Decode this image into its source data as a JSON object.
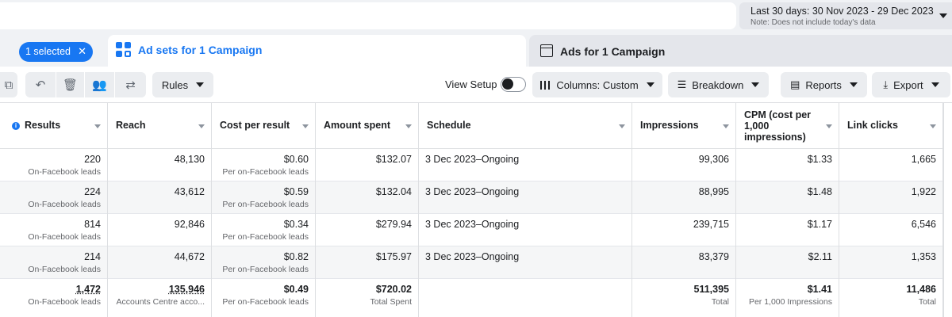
{
  "date_range": {
    "label": "Last 30 days: 30 Nov 2023 - 29 Dec 2023",
    "note": "Note: Does not include today's data"
  },
  "tabs": {
    "selected_pill": "1 selected",
    "pill_close": "✕",
    "active": "Ad sets for 1 Campaign",
    "inactive": "Ads for 1 Campaign"
  },
  "toolbar": {
    "rules": "Rules",
    "view_setup": "View Setup",
    "columns": "Columns: Custom",
    "breakdown": "Breakdown",
    "reports": "Reports",
    "export": "Export"
  },
  "columns": [
    {
      "key": "results",
      "label": "Results"
    },
    {
      "key": "reach",
      "label": "Reach"
    },
    {
      "key": "cpr",
      "label": "Cost per result"
    },
    {
      "key": "spent",
      "label": "Amount spent"
    },
    {
      "key": "schedule",
      "label": "Schedule"
    },
    {
      "key": "impressions",
      "label": "Impressions"
    },
    {
      "key": "cpm",
      "label": "CPM (cost per 1,000 impressions)"
    },
    {
      "key": "clicks",
      "label": "Link clicks"
    }
  ],
  "cpm_label_lines": [
    "CPM (cost per",
    "1,000",
    "impressions)"
  ],
  "rows": [
    {
      "results": "220",
      "results_sub": "On-Facebook leads",
      "reach": "48,130",
      "cpr": "$0.60",
      "cpr_sub": "Per on-Facebook leads",
      "spent": "$132.07",
      "schedule": "3 Dec 2023–Ongoing",
      "impressions": "99,306",
      "cpm": "$1.33",
      "clicks": "1,665"
    },
    {
      "results": "224",
      "results_sub": "On-Facebook leads",
      "reach": "43,612",
      "cpr": "$0.59",
      "cpr_sub": "Per on-Facebook leads",
      "spent": "$132.04",
      "schedule": "3 Dec 2023–Ongoing",
      "impressions": "88,995",
      "cpm": "$1.48",
      "clicks": "1,922"
    },
    {
      "results": "814",
      "results_sub": "On-Facebook leads",
      "reach": "92,846",
      "cpr": "$0.34",
      "cpr_sub": "Per on-Facebook leads",
      "spent": "$279.94",
      "schedule": "3 Dec 2023–Ongoing",
      "impressions": "239,715",
      "cpm": "$1.17",
      "clicks": "6,546"
    },
    {
      "results": "214",
      "results_sub": "On-Facebook leads",
      "reach": "44,672",
      "cpr": "$0.82",
      "cpr_sub": "Per on-Facebook leads",
      "spent": "$175.97",
      "schedule": "3 Dec 2023–Ongoing",
      "impressions": "83,379",
      "cpm": "$2.11",
      "clicks": "1,353"
    }
  ],
  "totals": {
    "results": "1,472",
    "results_sub": "On-Facebook leads",
    "reach": "135,946",
    "reach_sub": "Accounts Centre acco...",
    "cpr": "$0.49",
    "cpr_sub": "Per on-Facebook leads",
    "spent": "$720.02",
    "spent_sub": "Total Spent",
    "impressions": "511,395",
    "impressions_sub": "Total",
    "cpm": "$1.41",
    "cpm_sub": "Per 1,000 Impressions",
    "clicks": "11,486",
    "clicks_sub": "Total"
  },
  "icons": [
    "copy-icon",
    "undo-icon",
    "trash-icon",
    "people-icon",
    "share-icon",
    "info-icon",
    "columns-icon",
    "breakdown-icon",
    "reports-icon",
    "export-icon",
    "grid-icon",
    "document-icon"
  ],
  "colors": {
    "accent": "#1877f2",
    "background": "#f0f2f5"
  }
}
